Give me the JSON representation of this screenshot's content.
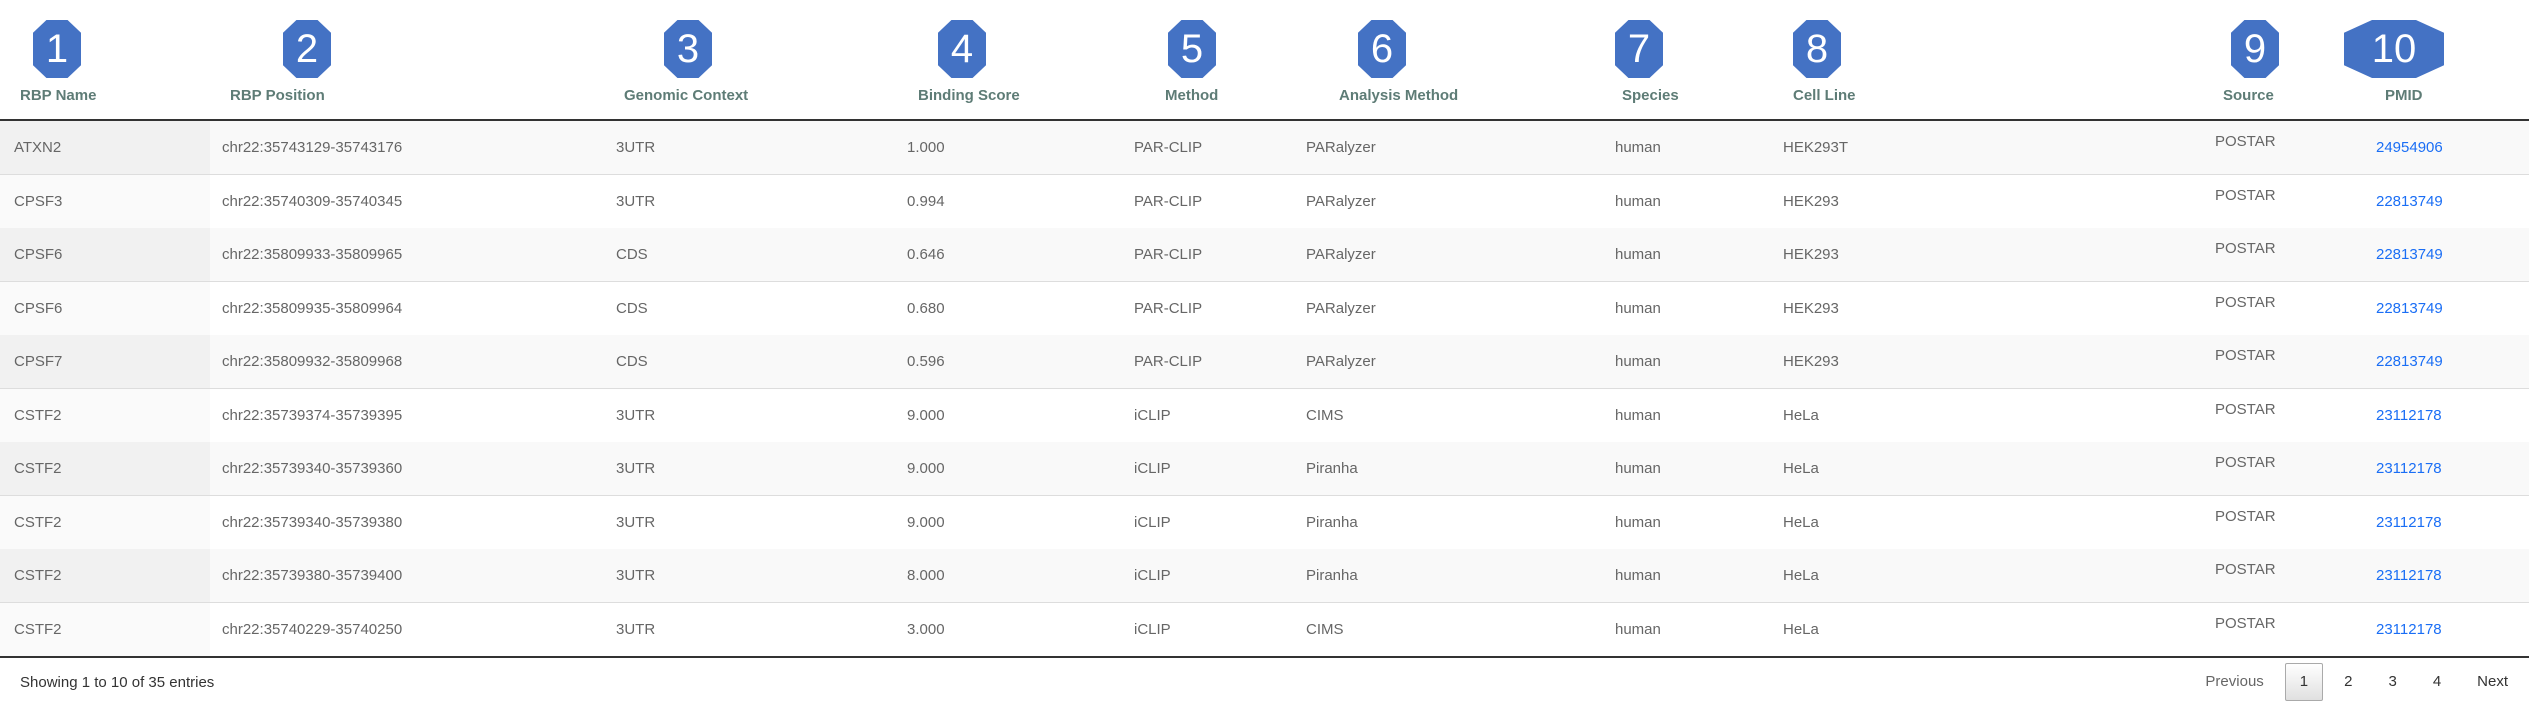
{
  "badges": [
    "1",
    "2",
    "3",
    "4",
    "5",
    "6",
    "7",
    "8",
    "9",
    "10"
  ],
  "columns": [
    "RBP Name",
    "RBP Position",
    "Genomic Context",
    "Binding Score",
    "Method",
    "Analysis Method",
    "Species",
    "Cell Line",
    "Source",
    "PMID"
  ],
  "rows": [
    [
      "ATXN2",
      "chr22:35743129-35743176",
      "3UTR",
      "1.000",
      "PAR-CLIP",
      "PARalyzer",
      "human",
      "HEK293T",
      "POSTAR",
      "24954906"
    ],
    [
      "CPSF3",
      "chr22:35740309-35740345",
      "3UTR",
      "0.994",
      "PAR-CLIP",
      "PARalyzer",
      "human",
      "HEK293",
      "POSTAR",
      "22813749"
    ],
    [
      "CPSF6",
      "chr22:35809933-35809965",
      "CDS",
      "0.646",
      "PAR-CLIP",
      "PARalyzer",
      "human",
      "HEK293",
      "POSTAR",
      "22813749"
    ],
    [
      "CPSF6",
      "chr22:35809935-35809964",
      "CDS",
      "0.680",
      "PAR-CLIP",
      "PARalyzer",
      "human",
      "HEK293",
      "POSTAR",
      "22813749"
    ],
    [
      "CPSF7",
      "chr22:35809932-35809968",
      "CDS",
      "0.596",
      "PAR-CLIP",
      "PARalyzer",
      "human",
      "HEK293",
      "POSTAR",
      "22813749"
    ],
    [
      "CSTF2",
      "chr22:35739374-35739395",
      "3UTR",
      "9.000",
      "iCLIP",
      "CIMS",
      "human",
      "HeLa",
      "POSTAR",
      "23112178"
    ],
    [
      "CSTF2",
      "chr22:35739340-35739360",
      "3UTR",
      "9.000",
      "iCLIP",
      "Piranha",
      "human",
      "HeLa",
      "POSTAR",
      "23112178"
    ],
    [
      "CSTF2",
      "chr22:35739340-35739380",
      "3UTR",
      "9.000",
      "iCLIP",
      "Piranha",
      "human",
      "HeLa",
      "POSTAR",
      "23112178"
    ],
    [
      "CSTF2",
      "chr22:35739380-35739400",
      "3UTR",
      "8.000",
      "iCLIP",
      "Piranha",
      "human",
      "HeLa",
      "POSTAR",
      "23112178"
    ],
    [
      "CSTF2",
      "chr22:35740229-35740250",
      "3UTR",
      "3.000",
      "iCLIP",
      "CIMS",
      "human",
      "HeLa",
      "POSTAR",
      "23112178"
    ]
  ],
  "footer": {
    "info": "Showing 1 to 10 of 35 entries",
    "previous": "Previous",
    "pages": [
      "1",
      "2",
      "3",
      "4"
    ],
    "current_page": "1",
    "next": "Next"
  },
  "colors": {
    "badge": "#4472c4",
    "link": "#1a6ef5",
    "header": "#5e7c76"
  }
}
